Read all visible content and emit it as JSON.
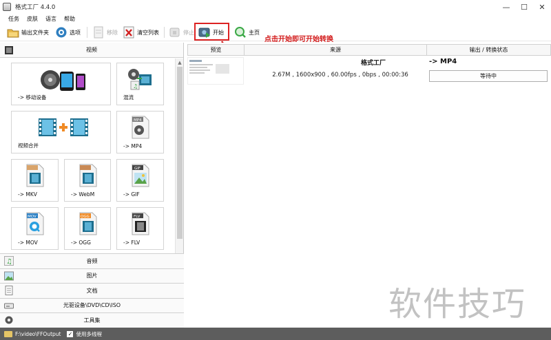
{
  "window": {
    "title": "格式工厂 4.4.0",
    "controls": [
      "—",
      "☐",
      "✕"
    ]
  },
  "menu": [
    "任务",
    "皮肤",
    "语言",
    "帮助"
  ],
  "toolbar": {
    "output_folder": "输出文件夹",
    "options": "选项",
    "remove": "移除",
    "clear_list": "清空列表",
    "stop": "停止",
    "start": "开始",
    "home": "主页"
  },
  "annotation": "点击开始即可开始转换",
  "left_panel": {
    "video_category": "视频",
    "tiles": [
      {
        "label": "-> 移动设备"
      },
      {
        "label": "混流"
      },
      {
        "label": "视频合并"
      },
      {
        "label": "-> MP4",
        "badge": "MP4"
      },
      {
        "label": "-> MKV",
        "badge": ""
      },
      {
        "label": "-> WebM",
        "badge": ""
      },
      {
        "label": "-> GIF",
        "badge": "GIF"
      },
      {
        "label": "-> MOV",
        "badge": "MOV"
      },
      {
        "label": "-> OGG",
        "badge": "OGG"
      },
      {
        "label": "-> FLV",
        "badge": "FLV"
      }
    ],
    "categories": [
      "音频",
      "图片",
      "文档",
      "光驱设备\\DVD\\CD\\ISO",
      "工具集"
    ]
  },
  "task_table": {
    "columns": [
      "预览",
      "来源",
      "输出 / 转换状态"
    ],
    "rows": [
      {
        "source_name": "格式工厂",
        "source_info": "2.67M , 1600x900 , 60.00fps , 0bps , 00:00:36",
        "target": "-> MP4",
        "status": "等待中"
      }
    ]
  },
  "statusbar": {
    "output_path": "F:\\video\\FFOutput",
    "multithread_label": "使用多线程",
    "multithread_checked": true
  },
  "watermark": "软件技巧",
  "colors": {
    "annotation": "#d21a1a",
    "status_bg": "#5d5d5d",
    "film": "#1d6e8e",
    "accent_orange": "#f08a24"
  }
}
